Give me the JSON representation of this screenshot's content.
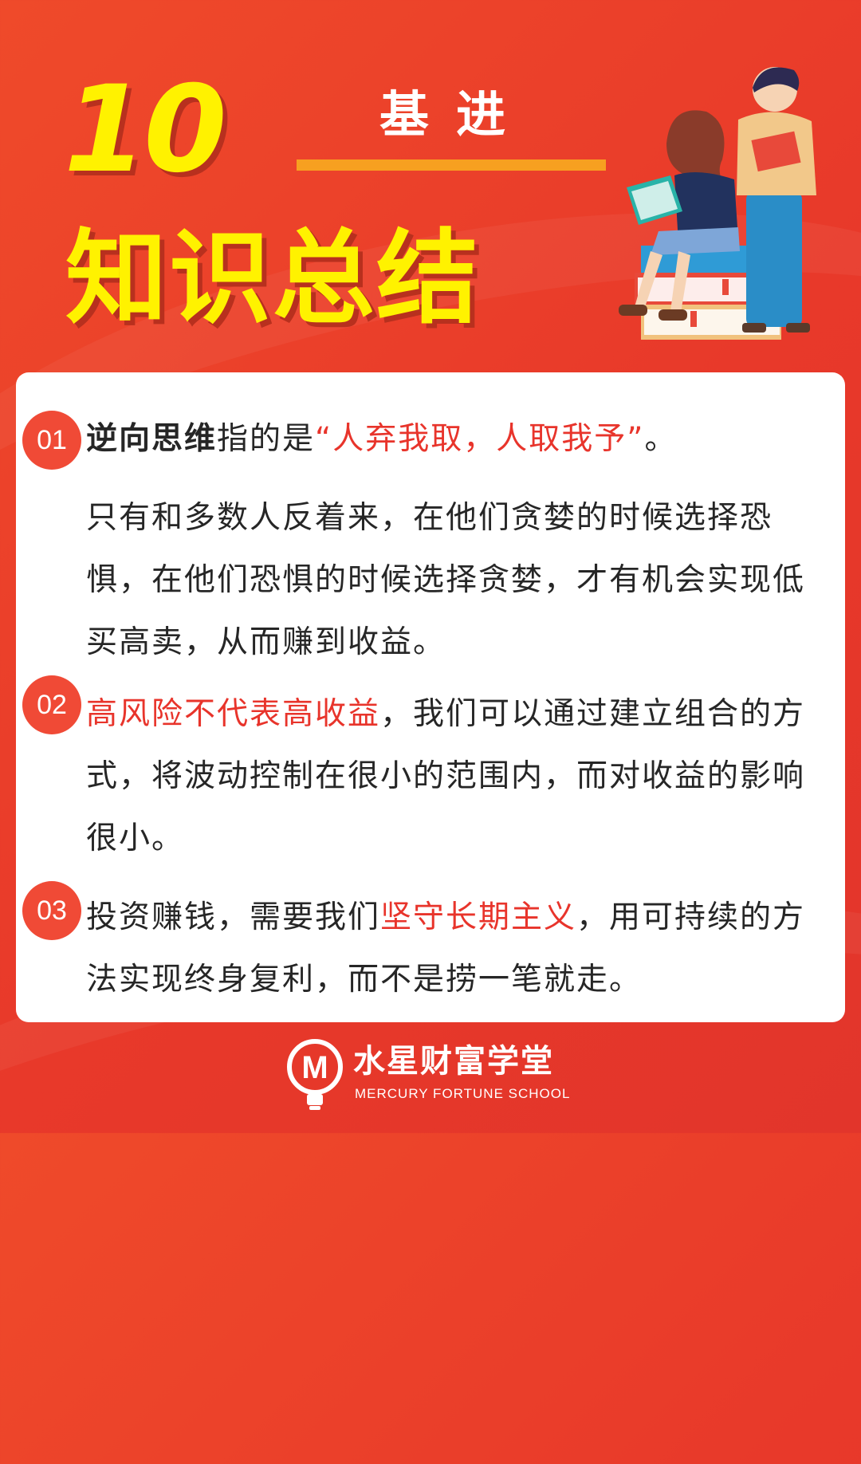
{
  "header": {
    "number": "10",
    "subtitle": "基进",
    "title": "知识总结"
  },
  "points": [
    {
      "badge": "01",
      "bold_term": "逆向思维",
      "lead": "指的是",
      "quote": "“人弃我取，人取我予”",
      "tail": "。",
      "detail": "只有和多数人反着来，在他们贪婪的时候选择恐惧，在他们恐惧的时候选择贪婪，才有机会实现低买高卖，从而赚到收益。"
    },
    {
      "badge": "02",
      "red_term": "高风险不代表高收益",
      "rest": "，我们可以通过建立组合的方式，将波动控制在很小的范围内，而对收益的影响很小。"
    },
    {
      "badge": "03",
      "lead": "投资赚钱，需要我们",
      "red_term": "坚守长期主义",
      "rest": "，用可持续的方法实现终身复利，而不是捞一笔就走。"
    }
  ],
  "footer": {
    "logo_letter": "M",
    "name": "水星财富学堂",
    "name_en": "MERCURY FORTUNE SCHOOL"
  },
  "colors": {
    "background": "#e8392a",
    "title_yellow": "#fff200",
    "accent_orange": "#f7a020",
    "highlight_red": "#e8342b",
    "badge_red": "#f04a36"
  },
  "icons": [
    "students-reading-illustration",
    "mercury-logo-icon"
  ]
}
